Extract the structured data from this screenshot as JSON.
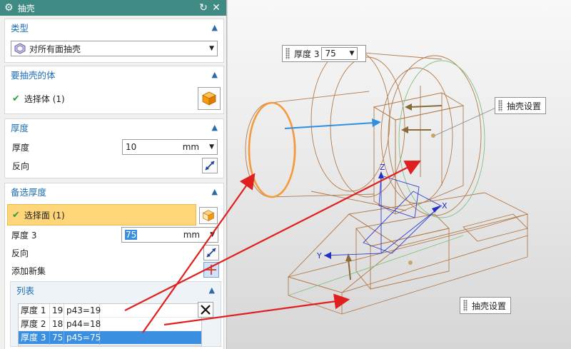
{
  "dialog": {
    "title": "抽壳",
    "type_section": {
      "label": "类型",
      "type_value": "对所有面抽壳"
    },
    "body_section": {
      "label": "要抽壳的体",
      "select_label": "选择体 (1)"
    },
    "thickness_section": {
      "label": "厚度",
      "thickness_label": "厚度",
      "thickness_value": "10",
      "unit": "mm",
      "reverse_label": "反向"
    },
    "alt_section": {
      "label": "备选厚度",
      "select_label": "选择面 (1)",
      "thickness_label": "厚度 3",
      "thickness_value": "75",
      "unit": "mm",
      "reverse_label": "反向",
      "add_label": "添加新集",
      "list": {
        "label": "列表",
        "rows": [
          {
            "name": "厚度 1",
            "value": "19",
            "expr": "p43=19"
          },
          {
            "name": "厚度 2",
            "value": "18",
            "expr": "p44=18"
          },
          {
            "name": "厚度 3",
            "value": "75",
            "expr": "p45=75"
          }
        ],
        "selected_index": 2
      }
    }
  },
  "viewport": {
    "callout_thickness": {
      "label": "厚度 3",
      "value": "75"
    },
    "callout_shell_1": "抽壳设置",
    "callout_shell_2": "抽壳设置",
    "axes": {
      "x": "X",
      "y": "Y",
      "z": "Z"
    }
  },
  "colors": {
    "title_bar": "#3f8a82",
    "section_header": "#1e6fb5",
    "highlight_row": "#ffd57a",
    "selection": "#3b8fe0",
    "model_edge": "#b27a4a",
    "selected_face": "#f59a3c",
    "arrow": "#e02020",
    "csys": "#3040d0",
    "direction_arrow": "#2f8fe0"
  }
}
